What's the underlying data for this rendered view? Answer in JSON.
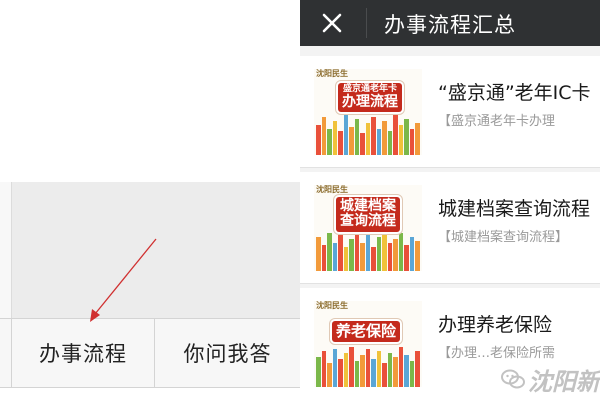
{
  "left_menu": {
    "items": [
      {
        "label": "办事流程"
      },
      {
        "label": "你问我答"
      }
    ]
  },
  "panel": {
    "title": "办事流程汇总",
    "close_icon": "close-icon"
  },
  "articles": [
    {
      "title": "“盛京通”老年IC卡",
      "subtitle": "【盛京通老年卡办理",
      "thumb_logo": "沈阳民生",
      "thumb_banner": [
        "盛京通老年卡",
        "办理流程"
      ]
    },
    {
      "title": "城建档案查询流程",
      "subtitle": "【城建档案查询流程】",
      "thumb_logo": "沈阳民生",
      "thumb_banner": [
        "城建档案",
        "查询流程"
      ]
    },
    {
      "title": "办理养老保险",
      "subtitle": "【办理…老保险所需",
      "thumb_logo": "沈阳民生",
      "thumb_banner": [
        "养老保险"
      ]
    }
  ],
  "watermark": {
    "text": "沈阳新",
    "icon": "wechat-icon"
  },
  "colors": {
    "header_bg": "#2f3133",
    "banner_red": "#c42a1c",
    "arrow": "#d03030"
  }
}
